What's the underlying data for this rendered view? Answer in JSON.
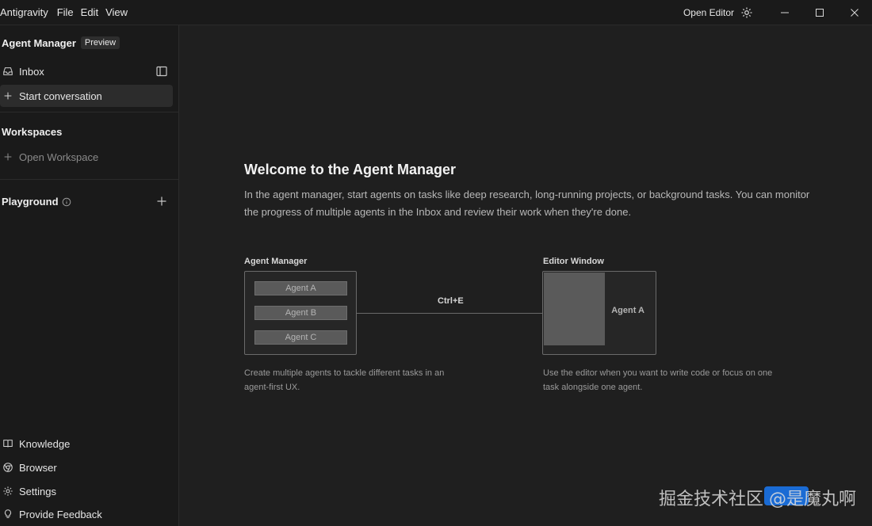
{
  "titlebar": {
    "app_name": "Antigravity",
    "menu": [
      "File",
      "Edit",
      "View"
    ],
    "open_editor": "Open Editor"
  },
  "sidebar": {
    "header": "Agent Manager",
    "badge": "Preview",
    "inbox": "Inbox",
    "start_conversation": "Start conversation",
    "workspaces_title": "Workspaces",
    "open_workspace": "Open Workspace",
    "playground_title": "Playground",
    "bottom": [
      "Knowledge",
      "Browser",
      "Settings",
      "Provide Feedback"
    ]
  },
  "main": {
    "title": "Welcome to the Agent Manager",
    "description": "In the agent manager, start agents on tasks like deep research, long-running projects, or background tasks. You can monitor the progress of multiple agents in the Inbox and review their work when they're done.",
    "diagram": {
      "left_label": "Agent Manager",
      "agents": [
        "Agent A",
        "Agent B",
        "Agent C"
      ],
      "shortcut": "Ctrl+E",
      "right_label": "Editor Window",
      "editor_agent": "Agent A",
      "left_caption": "Create multiple agents to tackle different tasks in an agent-first UX.",
      "right_caption": "Use the editor when you want to write code or focus on one task alongside one agent."
    }
  },
  "watermark": "掘金技术社区 @是魔丸啊",
  "colors": {
    "background": "#1f1f1f",
    "sidebar": "#1a1a1a",
    "accent": "#1a73e8"
  }
}
